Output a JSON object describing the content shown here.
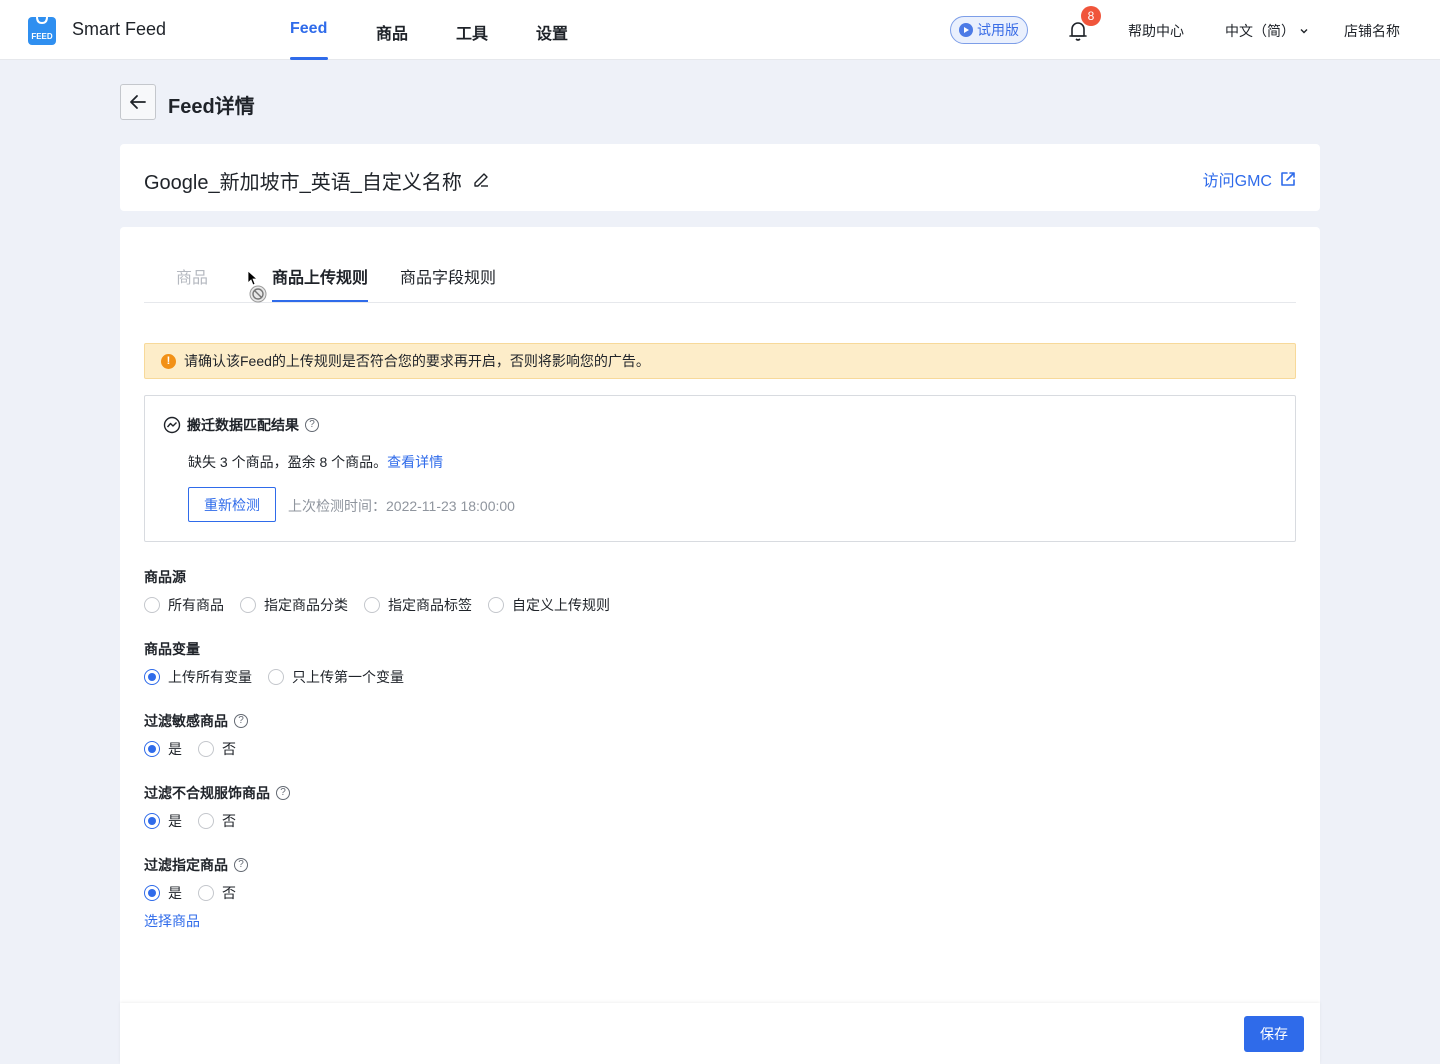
{
  "app": {
    "name": "Smart Feed",
    "logo_text": "FEED"
  },
  "nav": {
    "tabs": [
      {
        "label": "Feed",
        "active": true
      },
      {
        "label": "商品"
      },
      {
        "label": "工具"
      },
      {
        "label": "设置"
      }
    ],
    "trial_label": "试用版",
    "notification_count": "8",
    "help_label": "帮助中心",
    "language_label": "中文（简）",
    "store_label": "店铺名称"
  },
  "page": {
    "title": "Feed详情"
  },
  "feed": {
    "name": "Google_新加坡市_英语_自定义名称",
    "gmc_link": "访问GMC"
  },
  "tabs": [
    {
      "label": "商品",
      "state": "disabled"
    },
    {
      "label": "商品上传规则",
      "state": "active"
    },
    {
      "label": "商品字段规则",
      "state": "normal"
    }
  ],
  "alert": {
    "text": "请确认该Feed的上传规则是否符合您的要求再开启，否则将影响您的广告。"
  },
  "match": {
    "title": "搬迁数据匹配结果",
    "summary": "缺失 3 个商品，盈余 8 个商品。",
    "detail_link": "查看详情",
    "recheck_label": "重新检测",
    "last_check": "上次检测时间：2022-11-23 18:00:00"
  },
  "settings": {
    "source": {
      "label": "商品源",
      "options": [
        "所有商品",
        "指定商品分类",
        "指定商品标签",
        "自定义上传规则"
      ],
      "selected": null
    },
    "variants": {
      "label": "商品变量",
      "options": [
        "上传所有变量",
        "只上传第一个变量"
      ],
      "selected": "上传所有变量"
    },
    "sensitive": {
      "label": "过滤敏感商品",
      "options": [
        "是",
        "否"
      ],
      "selected": "是"
    },
    "apparel": {
      "label": "过滤不合规服饰商品",
      "options": [
        "是",
        "否"
      ],
      "selected": "是"
    },
    "specified": {
      "label": "过滤指定商品",
      "options": [
        "是",
        "否"
      ],
      "selected": "是"
    },
    "select_products_link": "选择商品"
  },
  "footer": {
    "save_label": "保存"
  },
  "colors": {
    "accent": "#2f6bea",
    "alert_bg": "#fdedc9",
    "badge": "#f0553b"
  }
}
